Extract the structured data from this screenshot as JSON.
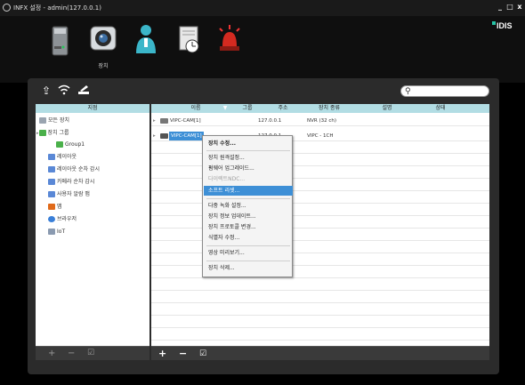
{
  "window": {
    "title": "INFX 설정 - admin(127.0.0.1)",
    "minimize": "_",
    "maximize": "□",
    "close": "x"
  },
  "header": {
    "logo": "IDIS",
    "active_label": "장치",
    "icons": [
      "server-icon",
      "camera-icon",
      "user-icon",
      "schedule-icon",
      "alarm-icon"
    ]
  },
  "toolbar": {
    "icons": [
      "upload-icon",
      "wifi-icon",
      "edit-icon"
    ],
    "search_icon": "search-icon"
  },
  "tree": {
    "header": "지점",
    "items": [
      {
        "label": "모든 장치",
        "color": "#9aa4b0"
      },
      {
        "label": "장치 그룹",
        "color": "#4ab04a"
      },
      {
        "label": "Group1",
        "color": "#4ab04a"
      },
      {
        "label": "레이아웃",
        "color": "#5a88d6"
      },
      {
        "label": "레이아웃 순차 감시",
        "color": "#5a88d6"
      },
      {
        "label": "카메라 순차 감시",
        "color": "#5a88d6"
      },
      {
        "label": "사용자 알람 맵",
        "color": "#5a88d6"
      },
      {
        "label": "맵",
        "color": "#e06a1a"
      },
      {
        "label": "브라우저",
        "color": "#3a7fd8"
      },
      {
        "label": "IoT",
        "color": "#8a9ab0"
      }
    ],
    "footer": {
      "add": "+",
      "remove": "−",
      "edit": "☑"
    }
  },
  "list": {
    "columns": {
      "name": "이름",
      "group": "그룹",
      "address": "주소",
      "type": "장치 종류",
      "desc": "설명",
      "status": "상태"
    },
    "rows": [
      {
        "name": "VIPC-CAM[1]",
        "group": "",
        "address": "127.0.0.1",
        "type": "NVR (32 ch)",
        "desc": "",
        "status": ""
      },
      {
        "name": "VIPC-CAM[1]",
        "group": "",
        "address": "127.0.0.1",
        "type": "VIPC - 1CH",
        "desc": "",
        "status": ""
      }
    ],
    "footer": {
      "add": "+",
      "remove": "−",
      "edit": "☑"
    }
  },
  "context_menu": {
    "items": [
      {
        "label": "장치 수정...",
        "state": "bold"
      },
      {
        "label": "장치 원격설정...",
        "state": ""
      },
      {
        "label": "펌웨어 업그레이드...",
        "state": ""
      },
      {
        "label": "다이렉트NDC...",
        "state": "disabled"
      },
      {
        "label": "소프트 리셋...",
        "state": "selected"
      },
      {
        "label": "다중 녹화 설정...",
        "state": ""
      },
      {
        "label": "장치 정보 업데이트...",
        "state": ""
      },
      {
        "label": "장치 프로토콜 변경...",
        "state": ""
      },
      {
        "label": "식별자 수정...",
        "state": ""
      },
      {
        "label": "영상 미리보기...",
        "state": ""
      },
      {
        "label": "장치 삭제...",
        "state": ""
      }
    ]
  },
  "colors": {
    "header_bar": "#b2dde4",
    "selection": "#3d8fd6",
    "panel": "#2b2b2b"
  }
}
